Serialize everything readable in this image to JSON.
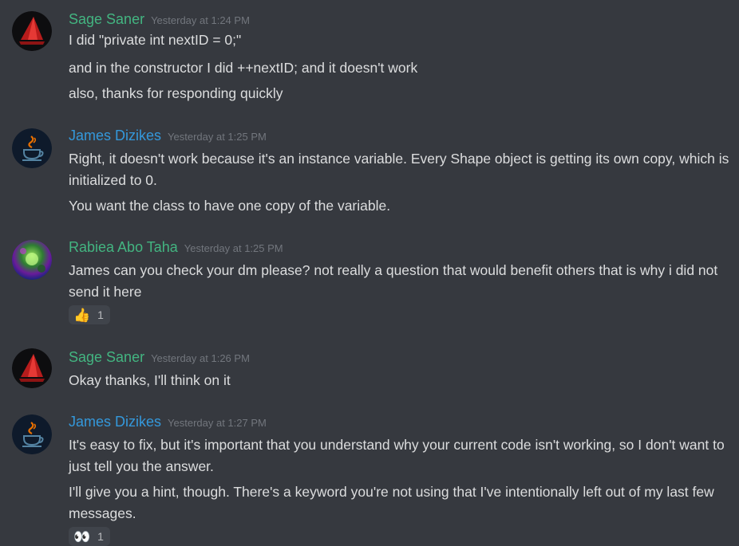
{
  "users": {
    "sage": {
      "name": "Sage Saner",
      "color": "#43b581"
    },
    "james": {
      "name": "James Dizikes",
      "color": "#3498db"
    },
    "rabiea": {
      "name": "Rabiea Abo Taha",
      "color": "#43b581"
    }
  },
  "groups": [
    {
      "author": "Sage Saner",
      "timestamp": "Yesterday at 1:24 PM",
      "messages": [
        "I did \"private int nextID = 0;\"",
        "and in the constructor I did ++nextID; and it doesn't work",
        "also, thanks for responding quickly"
      ]
    },
    {
      "author": "James Dizikes",
      "timestamp": "Yesterday at 1:25 PM",
      "messages": [
        "Right, it doesn't work because it's an instance variable. Every Shape object is getting its own copy, which is initialized to 0.",
        "You want the class to have one copy of the variable."
      ]
    },
    {
      "author": "Rabiea Abo Taha",
      "timestamp": "Yesterday at 1:25 PM",
      "messages": [
        "James can you check your dm please? not really a question that would benefit others that is why i did not send it here"
      ],
      "reaction": {
        "emoji": "👍",
        "icon": "thumbs-up-icon",
        "count": "1"
      }
    },
    {
      "author": "Sage Saner",
      "timestamp": "Yesterday at 1:26 PM",
      "messages": [
        "Okay thanks, I'll think on it"
      ]
    },
    {
      "author": "James Dizikes",
      "timestamp": "Yesterday at 1:27 PM",
      "messages": [
        "It's easy to fix, but it's important that you understand why your current code isn't working, so I don't want to just tell you the answer.",
        "I'll give you a hint, though. There's a keyword you're not using that I've intentionally left out of my last few messages."
      ],
      "reaction": {
        "emoji": "👀",
        "icon": "eyes-icon",
        "count": "1"
      }
    }
  ]
}
